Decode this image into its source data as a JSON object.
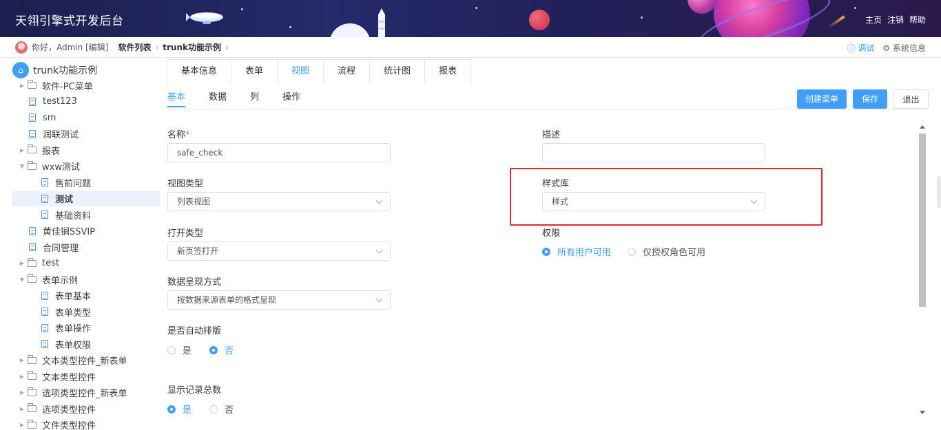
{
  "header": {
    "app_title": "天翎引擎式开发后台",
    "links": [
      "主页",
      "注销",
      "帮助"
    ]
  },
  "crumbbar": {
    "greeting": "你好，Admin [编辑]",
    "crumbs": [
      "软件列表",
      "trunk功能示例"
    ],
    "debug": "ⓘ 调试",
    "sysinfo": "⚙ 系统信息"
  },
  "sidebar": {
    "root": "trunk功能示例",
    "items": [
      {
        "label": "软件-PC菜单",
        "type": "folder"
      },
      {
        "label": "test123",
        "type": "doc"
      },
      {
        "label": "sm",
        "type": "doc"
      },
      {
        "label": "润联测试",
        "type": "doc"
      },
      {
        "label": "报表",
        "type": "folder"
      },
      {
        "label": "wxw测试",
        "type": "folder-open"
      },
      {
        "label": "售前问题",
        "type": "doc"
      },
      {
        "label": "测试",
        "type": "doc",
        "selected": true
      },
      {
        "label": "基础资料",
        "type": "doc"
      },
      {
        "label": "黄佳锏SSVIP",
        "type": "doc"
      },
      {
        "label": "合同管理",
        "type": "doc"
      },
      {
        "label": "test",
        "type": "folder"
      },
      {
        "label": "表单示例",
        "type": "folder-open"
      },
      {
        "label": "表单基本",
        "type": "doc"
      },
      {
        "label": "表单类型",
        "type": "doc"
      },
      {
        "label": "表单操作",
        "type": "doc"
      },
      {
        "label": "表单权限",
        "type": "doc"
      },
      {
        "label": "文本类型控件_新表单",
        "type": "folder"
      },
      {
        "label": "文本类型控件",
        "type": "folder"
      },
      {
        "label": "选项类型控件_新表单",
        "type": "folder"
      },
      {
        "label": "选项类型控件",
        "type": "folder"
      },
      {
        "label": "文件类型控件",
        "type": "folder"
      }
    ]
  },
  "main": {
    "tabs": [
      "基本信息",
      "表单",
      "视图",
      "流程",
      "统计图",
      "报表"
    ],
    "active_tab": "视图",
    "subtabs": [
      "基本",
      "数据",
      "列",
      "操作"
    ],
    "active_subtab": "基本",
    "buttons": {
      "create_menu": "创建菜单",
      "save": "保存",
      "exit": "退出"
    },
    "form": {
      "name_label": "名称",
      "required_mark": "*",
      "name_value": "safe_check",
      "desc_label": "描述",
      "desc_value": "",
      "view_type_label": "视图类型",
      "view_type_value": "列表视图",
      "style_lib_label": "样式库",
      "style_lib_value": "样式",
      "open_type_label": "打开类型",
      "open_type_value": "新页签打开",
      "permission_label": "权限",
      "perm_all": "所有用户可用",
      "perm_role": "仅授权角色可用",
      "display_label": "数据呈现方式",
      "display_value": "按数据来源表单的格式呈现",
      "auto_layout_label": "是否自动排版",
      "auto_yes": "是",
      "auto_no": "否",
      "show_total_label": "显示记录总数",
      "total_yes": "是",
      "total_no": "否"
    },
    "colors": {
      "accent": "#409eff",
      "highlight": "#e8232c"
    }
  }
}
